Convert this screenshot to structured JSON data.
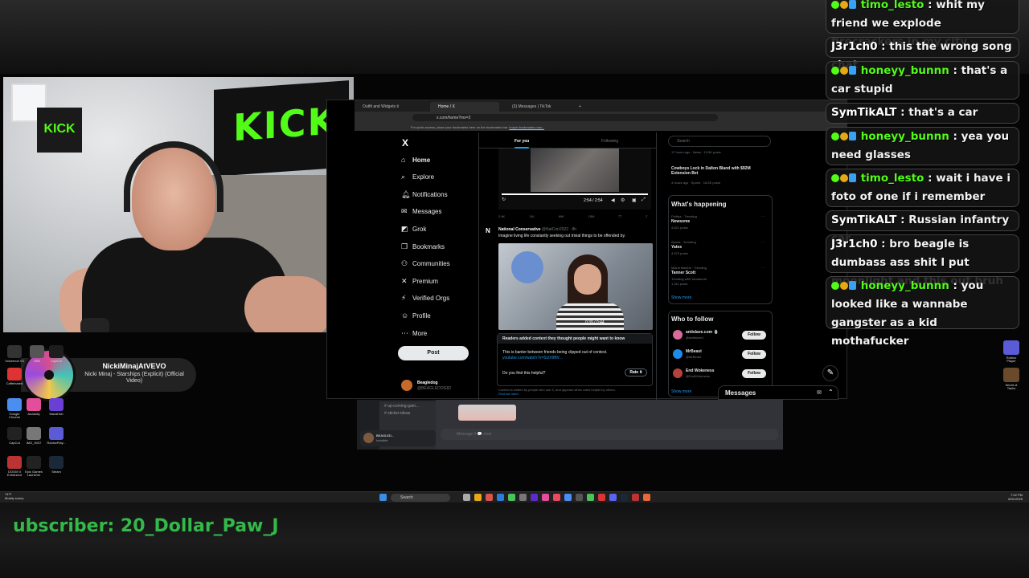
{
  "stream": {
    "subscriber_banner": "ubscriber: 20_Dollar_Paw_J"
  },
  "webcam": {
    "banner_text": "KICK",
    "small_banner_text": "KICK"
  },
  "now_playing": {
    "artist": "NickiMinajAtVEVO",
    "track": "Nicki Minaj - Starships (Explicit) (Official Video)"
  },
  "desktop_icons_left": [
    {
      "label": "Voicemod V3",
      "color": "#333"
    },
    {
      "label": "OBS",
      "color": "#555"
    },
    {
      "label": "CapCut",
      "color": "#1d1d1d"
    },
    {
      "label": "Caffeinated",
      "color": "#d33"
    },
    {
      "label": "Google Chrome",
      "color": "#4a8ff0"
    },
    {
      "label": "Audacity",
      "color": "#e44d9a"
    },
    {
      "label": "MaxaHub",
      "color": "#6a3fd4"
    },
    {
      "label": "CapCut",
      "color": "#222"
    },
    {
      "label": "IMG_9037",
      "color": "#777"
    },
    {
      "label": "RobloxPlay...",
      "color": "#5b5bd8"
    },
    {
      "label": "DOOM II Enhanced",
      "color": "#b33"
    },
    {
      "label": "Epic Games Launcher",
      "color": "#222"
    },
    {
      "label": "Steam",
      "color": "#1b2838"
    }
  ],
  "desktop_icons_right": [
    {
      "label": "Roblox Player",
      "color": "#5b5bd8"
    },
    {
      "label": "World of Tanks",
      "color": "#6b4a2b"
    }
  ],
  "browser": {
    "tabs": [
      {
        "label": "Outfit and Widgets ti",
        "active": false
      },
      {
        "label": "Home / X",
        "active": true
      },
      {
        "label": "(3) Messages | TikTok",
        "active": false
      }
    ],
    "new_tab": "+",
    "url": "x.com/home?mx=2",
    "bookmarks_hint": "For quick access, place your bookmarks here on the bookmarks bar.",
    "bookmarks_link": "Import bookmarks now..."
  },
  "x": {
    "logo": "X",
    "nav": [
      {
        "icon": "⌂",
        "icon_name": "home-icon",
        "label": "Home",
        "bold": true
      },
      {
        "icon": "⌕",
        "icon_name": "search-icon",
        "label": "Explore",
        "bold": false
      },
      {
        "icon": "🔔︎",
        "icon_name": "bell-icon",
        "label": "Notifications",
        "bold": false
      },
      {
        "icon": "✉",
        "icon_name": "mail-icon",
        "label": "Messages",
        "bold": false
      },
      {
        "icon": "◩",
        "icon_name": "grok-icon",
        "label": "Grok",
        "bold": false
      },
      {
        "icon": "❒",
        "icon_name": "bookmark-icon",
        "label": "Bookmarks",
        "bold": false
      },
      {
        "icon": "⚇",
        "icon_name": "communities-icon",
        "label": "Communities",
        "bold": false
      },
      {
        "icon": "✕",
        "icon_name": "x-premium-icon",
        "label": "Premium",
        "bold": false
      },
      {
        "icon": "⚡",
        "icon_name": "lightning-icon",
        "label": "Verified Orgs",
        "bold": false
      },
      {
        "icon": "☺",
        "icon_name": "profile-icon",
        "label": "Profile",
        "bold": false
      },
      {
        "icon": "⋯",
        "icon_name": "more-icon",
        "label": "More",
        "bold": false
      }
    ],
    "post_button": "Post",
    "profile": {
      "name": "Beagledog",
      "handle": "@BEAGLEDOG82"
    },
    "feed_tabs": [
      "For you",
      "Following"
    ],
    "video1_time": "2:54 / 2:54",
    "action_counts_1": [
      "2.8K",
      "11K",
      "69K",
      "15M"
    ],
    "tweet": {
      "author": "National Conservative",
      "handle": "@NatCon2022 · 8h",
      "avatar": "N",
      "text": "Imagine living life constantly seeking out trivial things to be offended by.",
      "video_time": "0:39 / 0:44"
    },
    "note": {
      "header": "Readers added context they thought people might want to know",
      "body": "This is banter between friends being clipped out of context.",
      "link": "youtube.com/watch?v=SUX9BV...",
      "question": "Do you find this helpful?",
      "rate_button": "Rate it",
      "footer": "Context is written by people who use X, and appears when rated helpful by others.",
      "footer_link": "Find out more."
    },
    "search_placeholder": "Search",
    "right_top": {
      "meta1": "17 hours ago · News · 19.9K posts",
      "headline": "Cowboys Lock in Dalton Bland with $92M Extension Bet",
      "meta2": "4 hours ago · Sports · 18.6K posts"
    },
    "whats_happening": {
      "title": "What's happening",
      "trends": [
        {
          "context": "Politics · Trending",
          "name": "Newsome",
          "count": "4,821 posts"
        },
        {
          "context": "Sports · Trending",
          "name": "Yates",
          "count": "4,073 posts"
        },
        {
          "context": "Miami Marlins · Trending",
          "name": "Tanner Scott",
          "extra": "Trending with Yamamoto",
          "count": "1,311 posts"
        }
      ],
      "show_more": "Show more"
    },
    "who_to_follow": {
      "title": "Who to follow",
      "accounts": [
        {
          "name": "antislave.com 🪬",
          "handle": "@antislave1",
          "button": "Follow",
          "color": "#d96b9a"
        },
        {
          "name": "MrBeast",
          "handle": "@MrBeast",
          "button": "Follow",
          "color": "#1f8be8"
        },
        {
          "name": "End Wokeness",
          "handle": "@EndWokeness",
          "button": "Follow",
          "color": "#b5413a"
        }
      ],
      "show_more": "Show more"
    },
    "messages_drawer": "Messages"
  },
  "discord": {
    "channels": [
      "# up-coming-gam...",
      "# sticker-ideas"
    ],
    "input_placeholder": "Message # 💬-chat",
    "user": {
      "name": "BEAGLED...",
      "status": "Invisible"
    }
  },
  "taskbar": {
    "weather_temp": "74°F",
    "weather_desc": "Mostly sunny",
    "search_label": "Search",
    "time": "7:02 PM",
    "date": "8/31/2025"
  },
  "chat": [
    {
      "user": "timo_lesto",
      "badges": [
        "green",
        "gold",
        "blue"
      ],
      "text": "whit my friend we explode firecrackers in my city",
      "user_color": "#53fc18"
    },
    {
      "user": "J3r1ch0",
      "badges": [],
      "text": "this the wrong song chat",
      "user_color": "#ffffff"
    },
    {
      "user": "honeyy_bunnn",
      "badges": [
        "green",
        "gold",
        "blue"
      ],
      "text": "that's a car stupid",
      "user_color": "#53fc18"
    },
    {
      "user": "SymTikALT",
      "badges": [],
      "text": "that's a car",
      "user_color": "#ffffff"
    },
    {
      "user": "honeyy_bunnn",
      "badges": [
        "green",
        "gold",
        "blue"
      ],
      "text": "yea you need glasses",
      "user_color": "#53fc18"
    },
    {
      "user": "timo_lesto",
      "badges": [
        "green",
        "gold",
        "blue"
      ],
      "text": "wait i have i foto of one if i remember",
      "user_color": "#53fc18"
    },
    {
      "user": "SymTikALT",
      "badges": [],
      "text": "Russian infantry car",
      "user_color": "#ffffff"
    },
    {
      "user": "J3r1ch0",
      "badges": [],
      "text": "bro beagle is dumbass ass shit I put moonlight and this out bruh",
      "user_color": "#ffffff"
    },
    {
      "user": "honeyy_bunnn",
      "badges": [
        "green",
        "gold",
        "blue"
      ],
      "text": "you looked like a wannabe gangster as a kid mothafucker",
      "user_color": "#53fc18"
    }
  ]
}
